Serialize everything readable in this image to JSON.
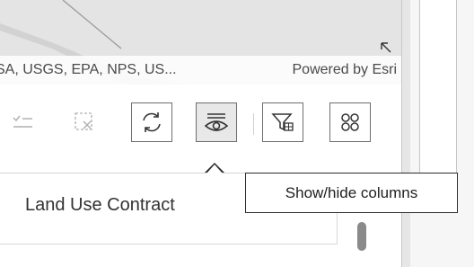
{
  "map": {
    "attribution": "SA, USGS, EPA, NPS, US...",
    "powered_by": "Powered by Esri",
    "expand_icon": "expand-arrow-icon"
  },
  "toolbar": {
    "buttons": [
      {
        "id": "show-selection",
        "icon": "list-check-icon",
        "state": "disabled"
      },
      {
        "id": "clear-selection",
        "icon": "clear-selection-icon",
        "state": "disabled"
      },
      {
        "id": "refresh",
        "icon": "refresh-icon",
        "state": "enabled"
      },
      {
        "id": "show-hide-columns",
        "icon": "eye-columns-icon",
        "state": "active"
      },
      {
        "id": "filter",
        "icon": "filter-table-icon",
        "state": "enabled"
      },
      {
        "id": "more",
        "icon": "grid-icon",
        "state": "enabled"
      }
    ]
  },
  "table": {
    "column_header": "Land Use Contract"
  },
  "tooltip": {
    "text": "Show/hide columns"
  }
}
